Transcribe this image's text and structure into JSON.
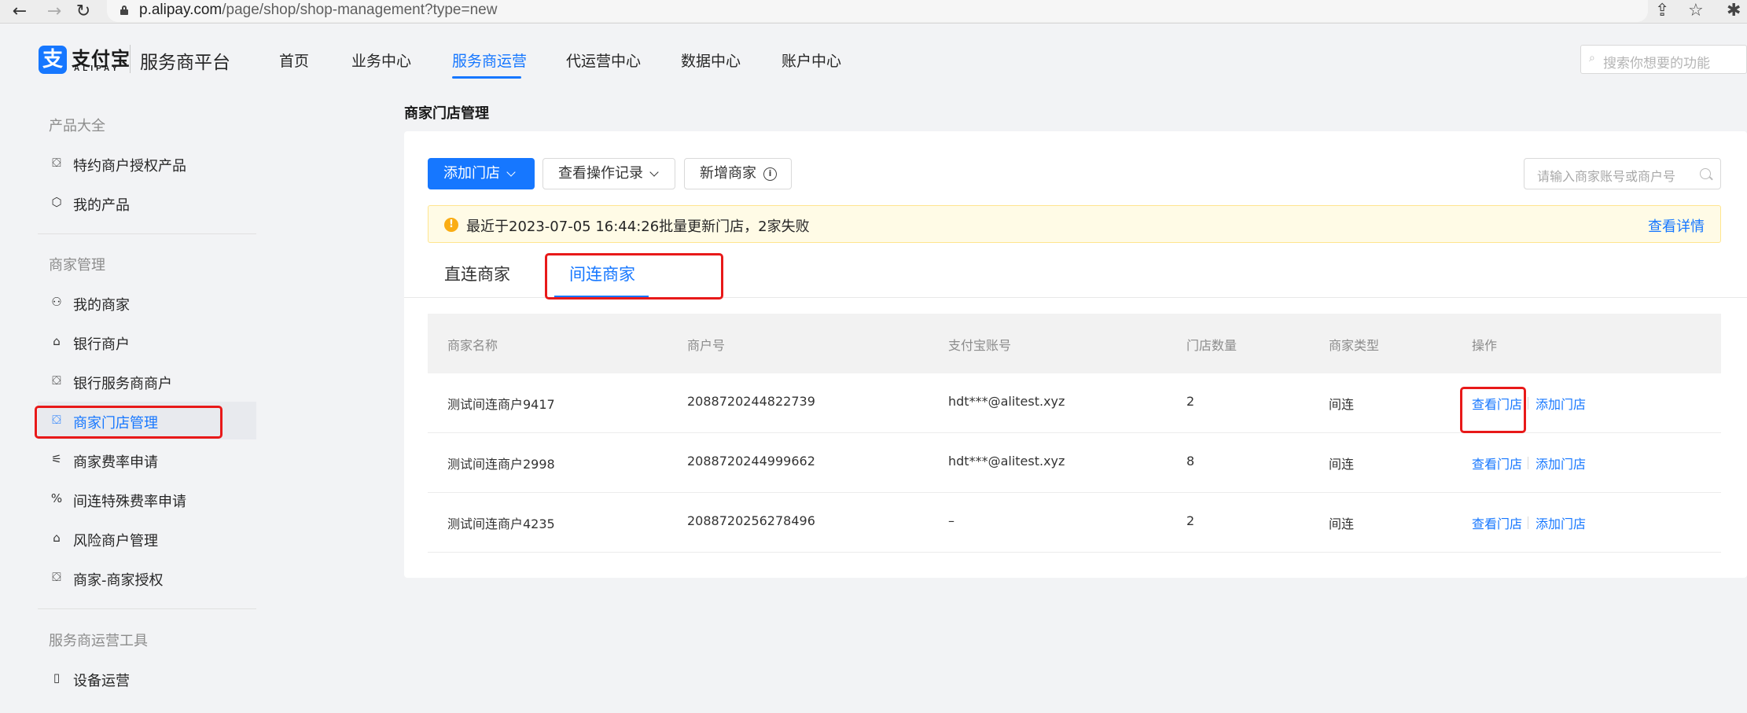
{
  "browser": {
    "back_icon": "←",
    "forward_icon": "→",
    "reload_icon": "↻",
    "url_host": "p.alipay.com",
    "url_path": "/page/shop/shop-management?type=new",
    "share_icon": "⇪",
    "star_icon": "☆",
    "extension_icon": "✱"
  },
  "header": {
    "logo_glyph": "支",
    "logo_cn": "支付宝",
    "logo_en": "ALIPAY",
    "platform_name": "服务商平台",
    "nav": [
      "首页",
      "业务中心",
      "服务商运营",
      "代运营中心",
      "数据中心",
      "账户中心"
    ],
    "active_nav": "服务商运营",
    "search_placeholder": "搜索你想要的功能"
  },
  "sidebar": {
    "sections": [
      {
        "title": "产品大全",
        "items": [
          {
            "label": "特约商户授权产品",
            "icon": "⛋"
          },
          {
            "label": "我的产品",
            "icon": "⬡"
          }
        ]
      },
      {
        "title": "商家管理",
        "items": [
          {
            "label": "我的商家",
            "icon": "⚇"
          },
          {
            "label": "银行商户",
            "icon": "⌂"
          },
          {
            "label": "银行服务商商户",
            "icon": "⛋"
          },
          {
            "label": "商家门店管理",
            "icon": "⛋",
            "active": true
          },
          {
            "label": "商家费率申请",
            "icon": "⚟"
          },
          {
            "label": "间连特殊费率申请",
            "icon": "%"
          },
          {
            "label": "风险商户管理",
            "icon": "⌂"
          },
          {
            "label": "商家-商家授权",
            "icon": "⛋"
          }
        ]
      },
      {
        "title": "服务商运营工具",
        "items": [
          {
            "label": "设备运营",
            "icon": "▯"
          }
        ]
      }
    ]
  },
  "page": {
    "title": "商家门店管理",
    "buttons": {
      "add_store": "添加门店",
      "view_records": "查看操作记录",
      "new_merchant": "新增商家",
      "info_glyph": "i"
    },
    "search_placeholder": "请输入商家账号或商户号",
    "alert": {
      "icon": "!",
      "text": "最近于2023-07-05 16:44:26批量更新门店，2家失败",
      "link": "查看详情"
    },
    "tabs": [
      "直连商家",
      "间连商家"
    ],
    "active_tab": "间连商家"
  },
  "table": {
    "columns": [
      "商家名称",
      "商户号",
      "支付宝账号",
      "门店数量",
      "商家类型",
      "操作"
    ],
    "rows": [
      {
        "name": "测试间连商户9417",
        "merchant_id": "2088720244822739",
        "account": "hdt***@alitest.xyz",
        "stores": "2",
        "type": "间连",
        "view": "查看门店",
        "add": "添加门店"
      },
      {
        "name": "测试间连商户2998",
        "merchant_id": "2088720244999662",
        "account": "hdt***@alitest.xyz",
        "stores": "8",
        "type": "间连",
        "view": "查看门店",
        "add": "添加门店"
      },
      {
        "name": "测试间连商户4235",
        "merchant_id": "2088720256278496",
        "account": "–",
        "stores": "2",
        "type": "间连",
        "view": "查看门店",
        "add": "添加门店"
      }
    ]
  },
  "colors": {
    "primary": "#1677ff",
    "annotation": "#e81919",
    "alert_bg": "#fffbe6",
    "alert_icon": "#faad14"
  }
}
